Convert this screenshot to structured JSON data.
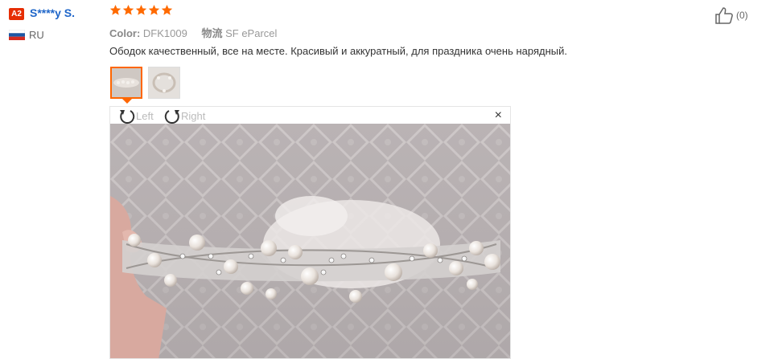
{
  "reviewer": {
    "level_badge": "A2",
    "name": "S****y S.",
    "country": "RU"
  },
  "rating": {
    "stars": 5,
    "max": 5,
    "color": "#ff6a00"
  },
  "meta": {
    "color_label": "Color:",
    "color_value": "DFK1009",
    "shipping_label": "物流",
    "shipping_value": "SF eParcel"
  },
  "review_text": "Ободок качественный, все на месте. Красивый и аккуратный, для праздника очень нарядный.",
  "viewer": {
    "rotate_left_label": "Left",
    "rotate_right_label": "Right",
    "close_label": "×"
  },
  "helpful": {
    "count_label": "(0)"
  },
  "colors": {
    "accent": "#ff6600",
    "link": "#1f66c9",
    "badge": "#e62e04"
  }
}
